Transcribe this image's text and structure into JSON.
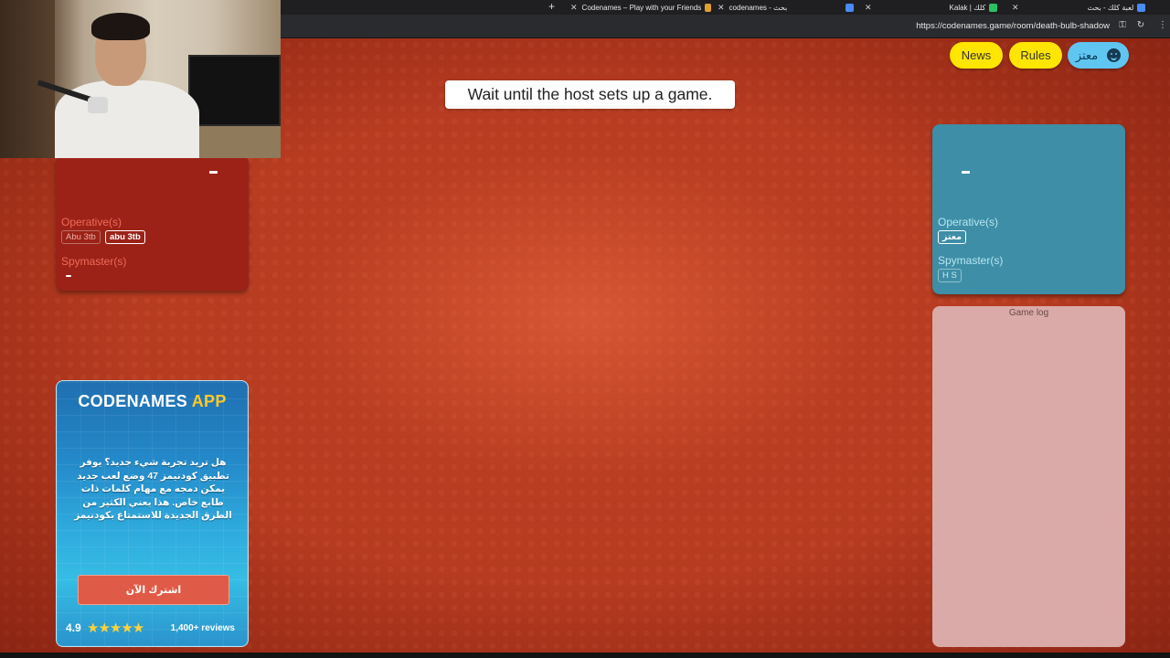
{
  "browser": {
    "tabs": [
      {
        "title": "Codenames – Play with your Friends",
        "color": "#e0a030"
      },
      {
        "title": "codenames - بحث",
        "color": "#4a8af4"
      },
      {
        "title": "Kalak | كلك",
        "color": "#2fbf62"
      },
      {
        "title": "لعبة كلك - بحث",
        "color": "#4a8af4"
      }
    ],
    "new_tab_symbol": "+",
    "close_symbol": "✕",
    "url": "https://codenames.game/room/death-bulb-shadow"
  },
  "header": {
    "news_label": "News",
    "rules_label": "Rules",
    "user_name": "معتز"
  },
  "banner": {
    "text": "Wait until the host sets up a game."
  },
  "red_team": {
    "score": "–",
    "operatives_label": "Operative(s)",
    "operatives": [
      "Abu 3tb",
      "abu 3tb"
    ],
    "spymasters_label": "Spymaster(s)",
    "spymaster_placeholder": "–"
  },
  "blue_team": {
    "score": "–",
    "operatives_label": "Operative(s)",
    "operatives": [
      "معتز"
    ],
    "spymasters_label": "Spymaster(s)",
    "spymasters": [
      "H S"
    ]
  },
  "game_log": {
    "title": "Game log"
  },
  "ad": {
    "title_main": "CODENAMES",
    "title_accent": "APP",
    "text": "هل تريد تجربة شيء جديد؟ يوفر تطبيق كودنيمز 47 وضع لعب جديد يمكن دمجه مع مهام كلمات ذات طابع خاص. هذا يعني الكثير من الطرق الجديدة للاستمتاع بكودنيمز",
    "button_label": "اشترك الآن",
    "rating": "4.9",
    "stars": "★★★★★",
    "reviews": "1,400+ reviews"
  },
  "colors": {
    "background": "#b43a1f",
    "red_team": "#9c2218",
    "blue_team": "#3d8ea6",
    "pill_yellow": "#ffe600",
    "pill_blue": "#5fc6f2"
  }
}
